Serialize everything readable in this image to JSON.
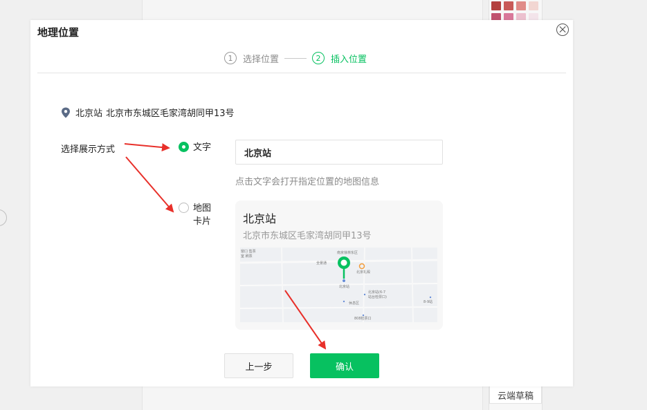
{
  "background": {
    "draft_button": "云端草稿",
    "swatch_colors": [
      "#b3403f",
      "#c85a58",
      "#e08b88",
      "#f2d6d2",
      "#c0526f",
      "#d9789a",
      "#ecc1cf",
      "#f3e4ea"
    ]
  },
  "dialog": {
    "title": "地理位置",
    "close_icon": "⨉",
    "steps": [
      {
        "num": "1",
        "label": "选择位置",
        "active": false
      },
      {
        "num": "2",
        "label": "插入位置",
        "active": true
      }
    ],
    "location": {
      "name": "北京站",
      "address": "北京市东城区毛家湾胡同甲13号",
      "icon": "map-pin-icon"
    },
    "display_mode": {
      "label": "选择展示方式",
      "options": [
        {
          "label": "文字",
          "checked": true
        },
        {
          "label_line1": "地图",
          "label_line2": "卡片",
          "checked": false
        }
      ]
    },
    "text_input_value": "北京站",
    "hint": "点击文字会打开指定位置的地图信息",
    "card": {
      "name": "北京站",
      "address": "北京市东城区毛家湾胡同甲13号"
    },
    "map_labels": {
      "l1": "窗口 售票",
      "l2": "室 刷票",
      "l3": "南京徐林东区",
      "l4": "全景通",
      "l5": "北京站",
      "l6": "北京站(6-7",
      "l7": "站台检票口)",
      "l8": "北京礼殿",
      "l9": "休息区",
      "l10": "8-9站",
      "l11": "808检票口",
      "l12": "·售票"
    },
    "buttons": {
      "prev": "上一步",
      "confirm": "确认"
    },
    "accent_color": "#07c160",
    "annotation_color": "#e8302a"
  }
}
